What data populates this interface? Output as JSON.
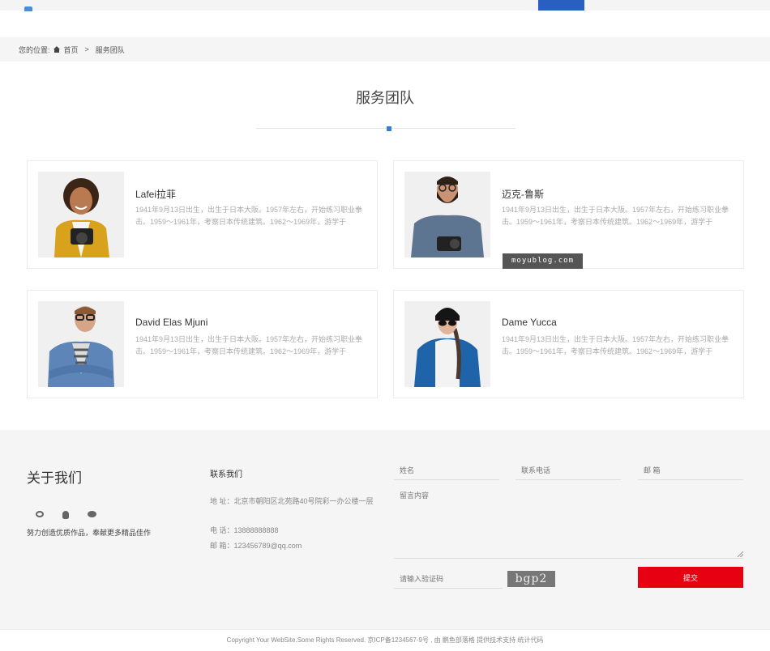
{
  "breadcrumb": {
    "prefix": "您的位置:",
    "home": "首页",
    "separator": ">",
    "current": "服务团队"
  },
  "section": {
    "title": "服务团队"
  },
  "team": [
    {
      "name": "Lafei拉菲",
      "desc": "1941年9月13日出生，出生于日本大阪。1957年左右，开始练习职业拳击。1959～1961年，考察日本传统建筑。1962～1969年，游学于"
    },
    {
      "name": "迈克-鲁斯",
      "desc": "1941年9月13日出生，出生于日本大阪。1957年左右，开始练习职业拳击。1959～1961年，考察日本传统建筑。1962～1969年，游学于"
    },
    {
      "name": "David Elas Mjuni",
      "desc": "1941年9月13日出生，出生于日本大阪。1957年左右，开始练习职业拳击。1959～1961年，考察日本传统建筑。1962～1969年，游学于"
    },
    {
      "name": "Dame Yucca",
      "desc": "1941年9月13日出生，出生于日本大阪。1957年左右，开始练习职业拳击。1959～1961年，考察日本传统建筑。1962～1969年，游学于"
    }
  ],
  "watermark": "moyublog.com",
  "footer": {
    "about_title": "关于我们",
    "slogan": "努力创造优质作品，奉献更多精品佳作",
    "contact_title": "联系我们",
    "address": "地 址：北京市朝阳区北苑路40号院彩一办公楼一层",
    "phone": "电 话：13888888888",
    "email": "邮 箱：123456789@qq.com",
    "form": {
      "name_placeholder": "姓名",
      "phone_placeholder": "联系电话",
      "email_placeholder": "邮 箱",
      "message_placeholder": "留言内容",
      "captcha_placeholder": "请输入验证码",
      "captcha_text": "bgp2",
      "submit_label": "提交"
    }
  },
  "copyright": "Copyright Your WebSite.Some Rights Reserved. 京ICP备1234567-9号 , 由 鹏鱼部落格 提供技术支持 统计代码"
}
